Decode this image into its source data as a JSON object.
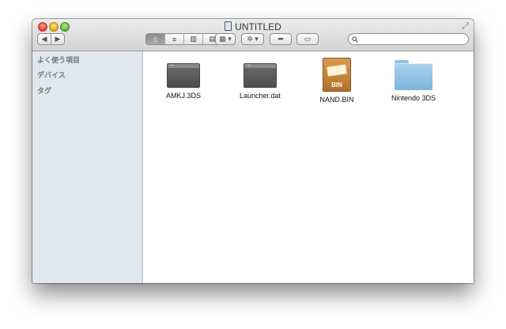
{
  "window": {
    "title": "UNTITLED"
  },
  "toolbar": {
    "back_glyph": "◀",
    "forward_glyph": "▶",
    "view_modes": [
      {
        "name": "icon-view",
        "glyph": "⁞⁞"
      },
      {
        "name": "list-view",
        "glyph": "≡"
      },
      {
        "name": "column-view",
        "glyph": "▥"
      },
      {
        "name": "coverflow-view",
        "glyph": "▤"
      }
    ],
    "arrange_glyph": "▦ ▾",
    "action_glyph": "✲ ▾",
    "share_glyph": "➦",
    "tags_glyph": "▭"
  },
  "search": {
    "placeholder": "",
    "icon": "search-icon"
  },
  "sidebar": {
    "sections": [
      {
        "label": "よく使う項目"
      },
      {
        "label": "デバイス"
      },
      {
        "label": "タグ"
      }
    ]
  },
  "files": [
    {
      "name": "AMKJ.3DS",
      "icon": "exec-icon"
    },
    {
      "name": "Launcher.dat",
      "icon": "exec-icon"
    },
    {
      "name": "NAND.BIN",
      "icon": "archive-icon",
      "badge": "BIN"
    },
    {
      "name": "Nintendo 3DS",
      "icon": "folder-icon"
    }
  ],
  "colors": {
    "sidebar_bg": "#e1e7ee",
    "folder": "#8fbfe3",
    "archive": "#c98a45"
  }
}
